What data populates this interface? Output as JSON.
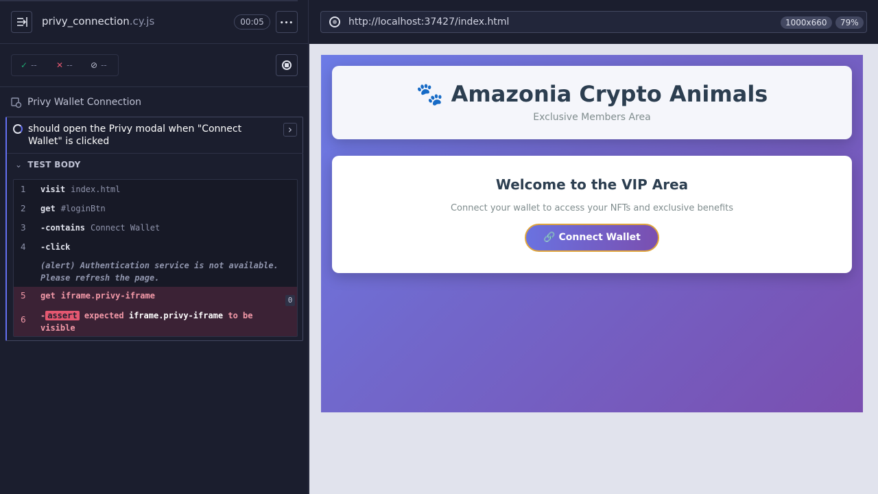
{
  "reporter": {
    "spec_name": "privy_connection",
    "spec_ext": ".cy.js",
    "timer": "00:05",
    "more_label": "•••",
    "stats": {
      "passed_glyph": "✓",
      "passed": "--",
      "failed_glyph": "✕",
      "failed": "--",
      "pending_glyph": "⊘",
      "pending": "--"
    },
    "suite_title": "Privy Wallet Connection",
    "test_title": "should open the Privy modal when \"Connect Wallet\" is clicked",
    "chevron_glyph": "›",
    "test_body_label": "TEST BODY",
    "test_body_chevron": "⌄",
    "commands": [
      {
        "num": "1",
        "name": "visit",
        "message": "index.html"
      },
      {
        "num": "2",
        "name": "get",
        "message": "#loginBtn"
      },
      {
        "num": "3",
        "name": "-contains",
        "message": "Connect Wallet"
      },
      {
        "num": "4",
        "name": "-click",
        "message": ""
      }
    ],
    "alert_text": "(alert)  Authentication service is not available. Please refresh the page.",
    "failed_commands": {
      "get_num": "5",
      "get_name": "get",
      "get_message": "iframe.privy-iframe",
      "get_count": "0",
      "assert_num": "6",
      "assert_dash": "-",
      "assert_tag": "assert",
      "assert_expected": "expected",
      "assert_subject": "iframe.privy-iframe",
      "assert_rest": "to be",
      "assert_wrap": "visible"
    }
  },
  "aut": {
    "url": "http://localhost:37427/index.html",
    "viewport_size": "1000x660",
    "zoom": "79%",
    "page": {
      "header_title": "🐾 Amazonia Crypto Animals",
      "header_subtitle": "Exclusive Members Area",
      "vip_title": "Welcome to the VIP Area",
      "vip_text": "Connect your wallet to access your NFTs and exclusive benefits",
      "connect_button": "🔗 Connect Wallet"
    }
  },
  "colors": {
    "accent": "#6470f3",
    "failed_bg": "#3b2235",
    "failed_text": "#f59aa9",
    "assert_badge": "#e45770",
    "passed": "#1fa971",
    "failed": "#e45770"
  }
}
